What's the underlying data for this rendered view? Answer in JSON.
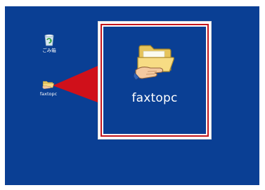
{
  "desktop": {
    "background_color": "#0a3f94",
    "icons": [
      {
        "label": "ごみ箱",
        "icon": "recycle-bin-icon"
      },
      {
        "label": "faxtopc",
        "icon": "shared-folder-icon"
      }
    ]
  },
  "zoom": {
    "label": "faxtopc",
    "icon": "shared-folder-icon",
    "border_color": "#c4161c",
    "callout_color": "#d0101a"
  }
}
